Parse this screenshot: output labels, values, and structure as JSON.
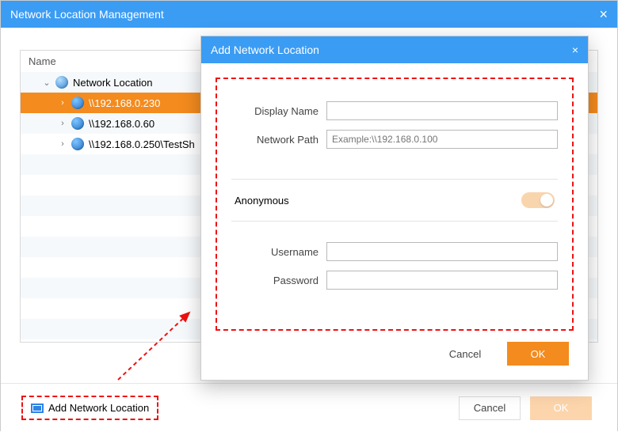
{
  "main": {
    "title": "Network Location Management",
    "tree_header": "Name",
    "tree": {
      "root_label": "Network Location",
      "items": [
        "\\\\192.168.0.230",
        "\\\\192.168.0.60",
        "\\\\192.168.0.250\\TestSh"
      ]
    },
    "add_button_label": "Add Network Location",
    "cancel_label": "Cancel",
    "ok_label": "OK"
  },
  "dialog": {
    "title": "Add Network Location",
    "display_name_label": "Display Name",
    "network_path_label": "Network Path",
    "network_path_placeholder": "Example:\\\\192.168.0.100",
    "anonymous_label": "Anonymous",
    "username_label": "Username",
    "password_label": "Password",
    "cancel_label": "Cancel",
    "ok_label": "OK"
  }
}
